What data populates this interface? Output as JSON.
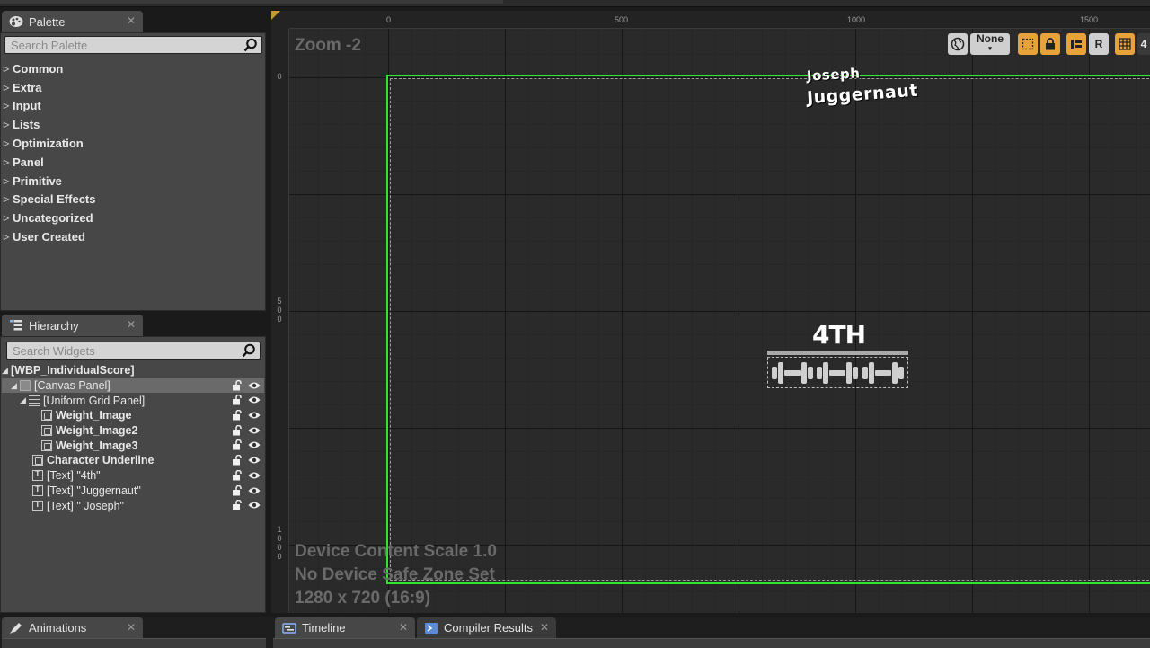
{
  "palette": {
    "tab_label": "Palette",
    "tab_icon": "palette-icon",
    "search_placeholder": "Search Palette",
    "categories": [
      "Common",
      "Extra",
      "Input",
      "Lists",
      "Optimization",
      "Panel",
      "Primitive",
      "Special Effects",
      "Uncategorized",
      "User Created"
    ]
  },
  "hierarchy": {
    "tab_label": "Hierarchy",
    "tab_icon": "hierarchy-list-icon",
    "search_placeholder": "Search Widgets",
    "root": "[WBP_IndividualScore]",
    "canvas": "[Canvas Panel]",
    "grid": "[Uniform Grid Panel]",
    "weight1": "Weight_Image",
    "weight2": "Weight_Image2",
    "weight3": "Weight_Image3",
    "underline": "Character Underline",
    "text_4th": "[Text] \"4th\"",
    "text_juggernaut": "[Text] \"Juggernaut\"",
    "text_joseph": "[Text] \" Joseph\""
  },
  "viewport": {
    "zoom": "Zoom -2",
    "ruler_top": [
      "0",
      "500",
      "1000",
      "1500"
    ],
    "ruler_left": [
      "0",
      "500",
      "1000"
    ],
    "toolbar": {
      "none_label": "None",
      "r_label": "R",
      "grid_snap": "4"
    },
    "info": {
      "scale": "Device Content Scale 1.0",
      "safe_zone": "No Device Safe Zone Set",
      "resolution": "1280 x 720 (16:9)"
    },
    "widgets": {
      "joseph": "Joseph",
      "juggernaut": "Juggernaut",
      "rank": "4TH"
    },
    "colors": {
      "design_frame": "#2ee62e",
      "toolbar_accent": "#e8a23a"
    }
  },
  "bottom": {
    "animations": "Animations",
    "timeline": "Timeline",
    "compiler": "Compiler Results"
  }
}
